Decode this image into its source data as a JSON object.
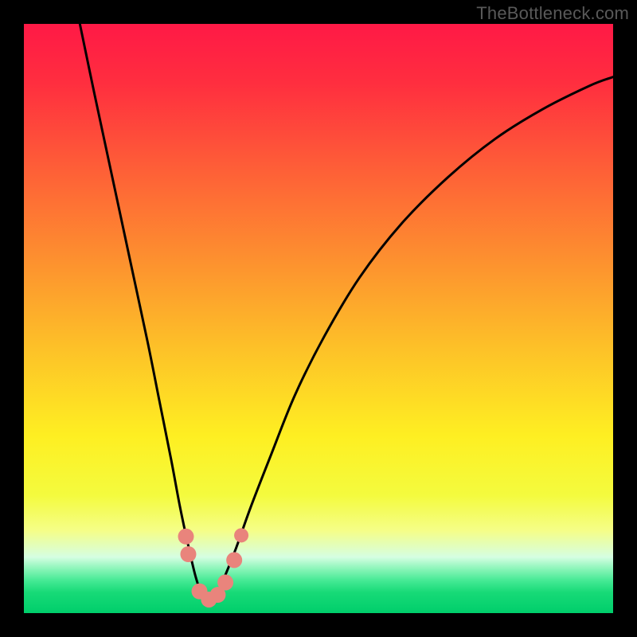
{
  "watermark": "TheBottleneck.com",
  "chart_data": {
    "type": "line",
    "title": "",
    "xlabel": "",
    "ylabel": "",
    "xlim": [
      0,
      100
    ],
    "ylim": [
      0,
      100
    ],
    "series": [
      {
        "name": "curve",
        "x": [
          9.5,
          12,
          15,
          18,
          21,
          23,
          25,
          26.5,
          28,
          29.2,
          30.3,
          31.4,
          32.6,
          34,
          36,
          38.5,
          42,
          46,
          51,
          57,
          64,
          72,
          80,
          88,
          96,
          100
        ],
        "y": [
          100,
          88,
          74,
          60,
          46,
          36,
          26,
          18,
          11,
          6,
          3,
          2.4,
          3,
          6,
          11,
          18,
          27,
          37,
          47,
          57,
          66,
          74,
          80.5,
          85.5,
          89.5,
          91
        ]
      }
    ],
    "markers": {
      "name": "pink-dots",
      "color": "#E9847C",
      "points": [
        {
          "x": 27.5,
          "y": 13,
          "r": 10
        },
        {
          "x": 27.9,
          "y": 10,
          "r": 10
        },
        {
          "x": 29.8,
          "y": 3.7,
          "r": 10
        },
        {
          "x": 31.4,
          "y": 2.3,
          "r": 10
        },
        {
          "x": 32.9,
          "y": 3.1,
          "r": 10
        },
        {
          "x": 34.2,
          "y": 5.2,
          "r": 10
        },
        {
          "x": 35.7,
          "y": 9.0,
          "r": 10
        },
        {
          "x": 36.9,
          "y": 13.2,
          "r": 9
        }
      ]
    },
    "gradient_stops": [
      {
        "offset": 0.0,
        "color": "#FF1946"
      },
      {
        "offset": 0.1,
        "color": "#FF2E3F"
      },
      {
        "offset": 0.25,
        "color": "#FE6037"
      },
      {
        "offset": 0.4,
        "color": "#FD902F"
      },
      {
        "offset": 0.55,
        "color": "#FDC128"
      },
      {
        "offset": 0.7,
        "color": "#FEEF22"
      },
      {
        "offset": 0.8,
        "color": "#F4FB3E"
      },
      {
        "offset": 0.86,
        "color": "#F5FE88"
      },
      {
        "offset": 0.905,
        "color": "#D5FEE2"
      },
      {
        "offset": 0.925,
        "color": "#8AF5B8"
      },
      {
        "offset": 0.945,
        "color": "#44E994"
      },
      {
        "offset": 0.965,
        "color": "#17DA77"
      },
      {
        "offset": 1.0,
        "color": "#00CE6B"
      }
    ]
  }
}
